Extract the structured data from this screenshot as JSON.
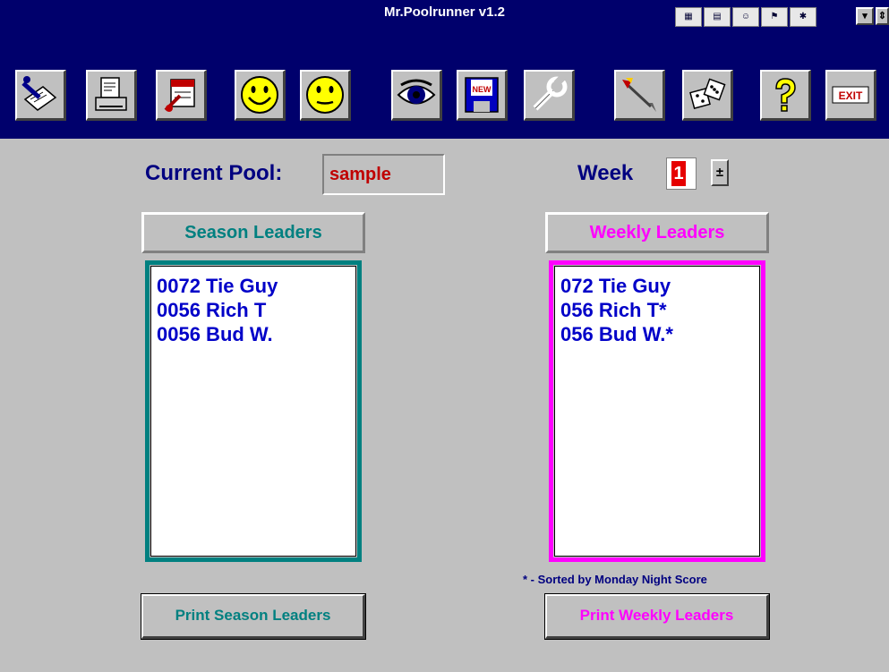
{
  "window": {
    "title": "Mr.Poolrunner v1.2"
  },
  "titlebar": {
    "tray_icons": [
      "calendar-tray-icon",
      "chart-tray-icon",
      "people-tray-icon",
      "flag-tray-icon",
      "puzzle-tray-icon"
    ],
    "dropdown_glyph": "▾",
    "next_glyph": "⇕"
  },
  "toolbar": {
    "buttons": [
      {
        "name": "edit-picks-button",
        "icon": "pen-paper-icon"
      },
      {
        "name": "print-button",
        "icon": "printer-icon"
      },
      {
        "name": "schedule-button",
        "icon": "calendar-pen-icon"
      },
      {
        "name": "winners-button",
        "icon": "happy-face-icon"
      },
      {
        "name": "losers-button",
        "icon": "neutral-face-icon"
      },
      {
        "name": "view-button",
        "icon": "eye-icon"
      },
      {
        "name": "new-pool-button",
        "icon": "floppy-new-icon"
      },
      {
        "name": "settings-button",
        "icon": "wrench-icon"
      },
      {
        "name": "dart-button",
        "icon": "dart-icon"
      },
      {
        "name": "dice-button",
        "icon": "dice-icon"
      },
      {
        "name": "help-button",
        "icon": "question-mark-icon"
      },
      {
        "name": "exit-button",
        "icon": "exit-icon"
      }
    ],
    "new_label": "NEW",
    "exit_label": "EXIT"
  },
  "pool": {
    "label": "Current Pool:",
    "value": "sample"
  },
  "week": {
    "label": "Week",
    "value": "1",
    "spin_glyph": "±"
  },
  "season": {
    "header": "Season Leaders",
    "items": [
      "0072 Tie Guy",
      "0056 Rich T",
      "0056 Bud W."
    ],
    "print_label": "Print Season Leaders"
  },
  "weekly": {
    "header": "Weekly Leaders",
    "items": [
      "072 Tie Guy",
      "056 Rich T*",
      "056 Bud W.*"
    ],
    "note": "* - Sorted by Monday Night Score",
    "print_label": "Print Weekly Leaders"
  },
  "colors": {
    "title_bar": "#00006c",
    "season_accent": "#008080",
    "weekly_accent": "#ff00ff",
    "list_text": "#0000c8",
    "pool_value": "#c00000"
  }
}
